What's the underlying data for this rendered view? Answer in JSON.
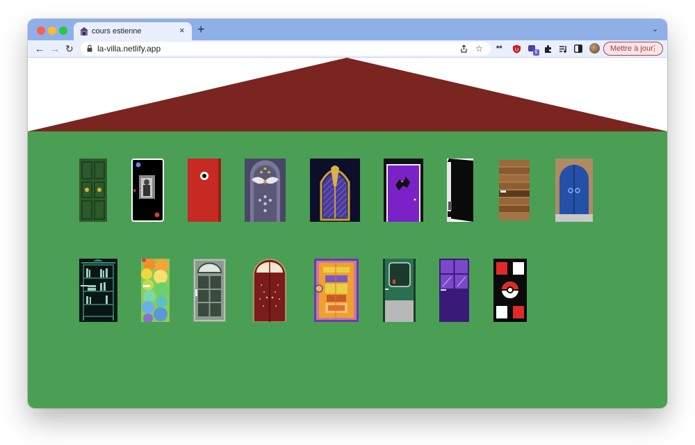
{
  "browser": {
    "tab_title": "cours estienne",
    "tab_close_icon": "close-icon",
    "new_tab_label": "+",
    "url": "la-villa.netlify.app",
    "extension_badge": "6",
    "update_button_label": "Mettre à jour",
    "traffic_colors": [
      "#ff5f57",
      "#febc2e",
      "#28c840"
    ]
  },
  "house": {
    "roof_color": "#7a2520",
    "wall_color": "#4a9f55",
    "row1_doors": [
      "green-paneled-door",
      "phone-screen-door",
      "red-eye-door",
      "owl-door",
      "golden-arch-lattice-door",
      "purple-bat-door",
      "open-dark-door",
      "wooden-plank-door",
      "blue-arched-door"
    ],
    "row2_doors": [
      "bookshelf-door",
      "colorful-bubbles-door",
      "gray-window-door",
      "red-arched-door",
      "ornate-orange-door",
      "green-window-door",
      "purple-glass-door",
      "pokeball-door"
    ]
  }
}
